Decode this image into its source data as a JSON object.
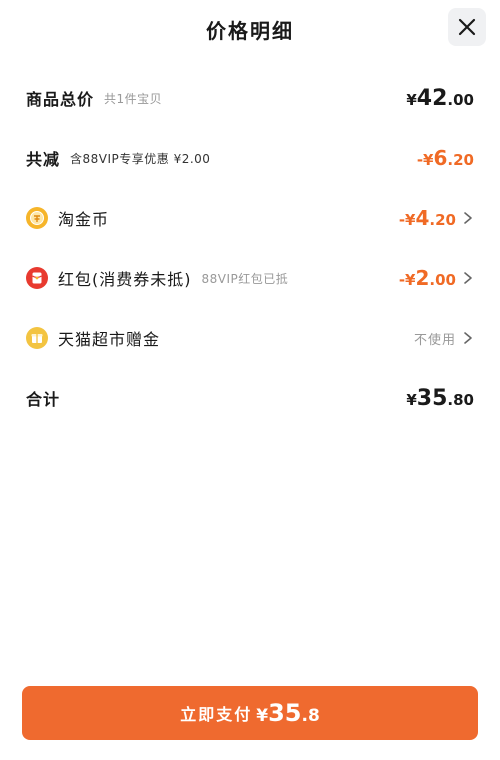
{
  "header": {
    "title": "价格明细"
  },
  "rows": {
    "goods_total": {
      "label": "商品总价",
      "sub": "共1件宝贝",
      "currency": "¥",
      "int": "42",
      "dec": ".00"
    },
    "total_discount": {
      "label": "共减",
      "sub": "含88VIP专享优惠 ¥2.00",
      "prefix": "-¥",
      "int": "6",
      "dec": ".20"
    },
    "taojinbi": {
      "label": "淘金币",
      "prefix": "-¥",
      "int": "4",
      "dec": ".20",
      "icon": "coin-icon",
      "icon_color": "#f6b52a"
    },
    "red_packet": {
      "label": "红包(消费券未抵)",
      "sub": "88VIP红包已抵",
      "prefix": "-¥",
      "int": "2",
      "dec": ".00",
      "icon": "red-packet-icon",
      "icon_color": "#e83a2f"
    },
    "tmall_gift": {
      "label": "天猫超市赠金",
      "status": "不使用",
      "icon": "gift-icon",
      "icon_color": "#f3c441"
    },
    "sum": {
      "label": "合计",
      "currency": "¥",
      "int": "35",
      "dec": ".80"
    }
  },
  "pay_button": {
    "label": "立即支付",
    "currency": "¥",
    "int": "35",
    "dec": ".8"
  },
  "colors": {
    "accent": "#ef6a2f",
    "discount": "#f06a25",
    "muted": "#999999"
  }
}
